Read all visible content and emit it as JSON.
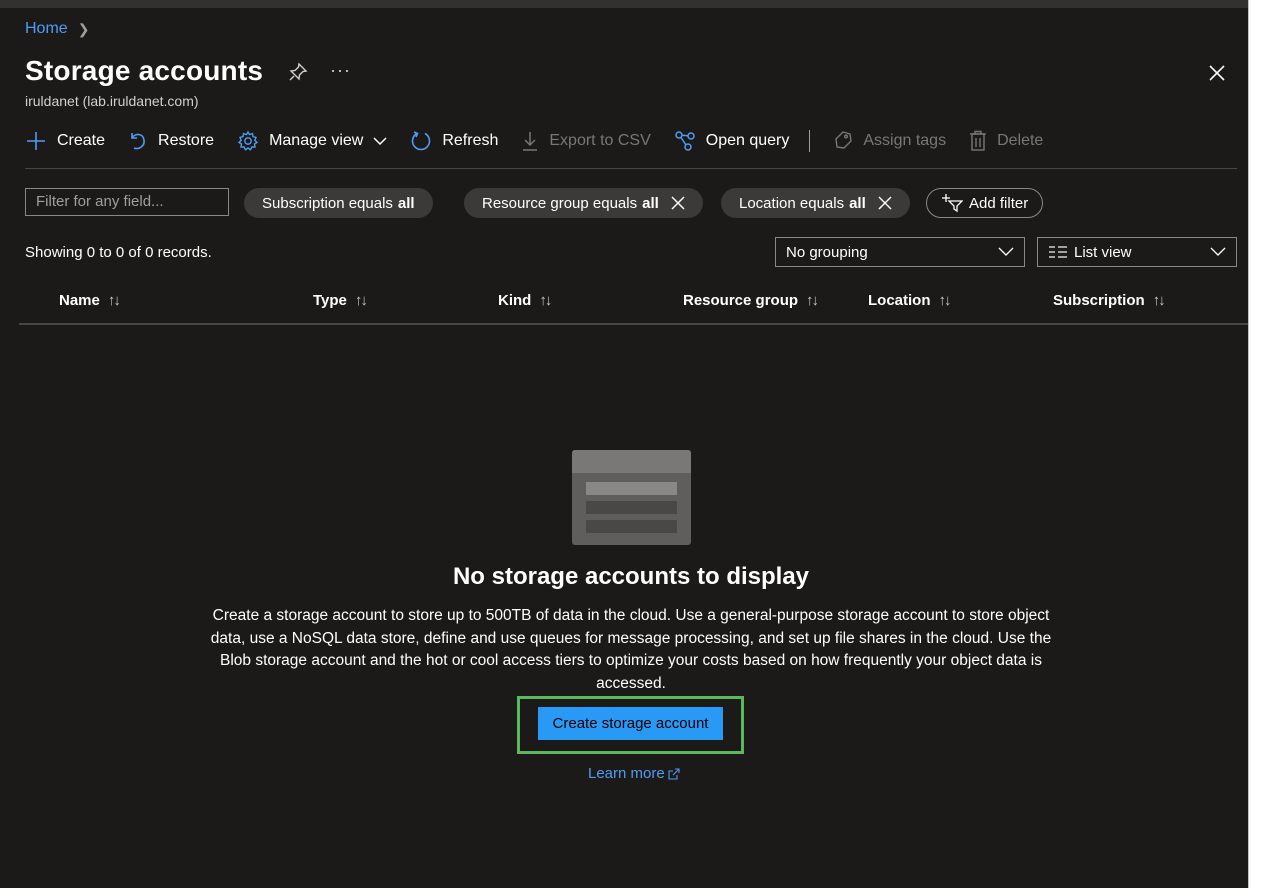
{
  "breadcrumb": {
    "home": "Home"
  },
  "header": {
    "title": "Storage accounts",
    "subtitle": "iruldanet (lab.iruldanet.com)",
    "more": "···"
  },
  "toolbar": {
    "create": "Create",
    "restore": "Restore",
    "manage_view": "Manage view",
    "refresh": "Refresh",
    "export_csv": "Export to CSV",
    "open_query": "Open query",
    "assign_tags": "Assign tags",
    "delete": "Delete"
  },
  "filters": {
    "placeholder": "Filter for any field...",
    "subscription": {
      "label": "Subscription equals",
      "value": "all"
    },
    "resource_group": {
      "label": "Resource group equals",
      "value": "all"
    },
    "location": {
      "label": "Location equals",
      "value": "all"
    },
    "add_filter": "Add filter"
  },
  "records": "Showing 0 to 0 of 0 records.",
  "grouping": "No grouping",
  "view": "List view",
  "columns": [
    "Name",
    "Type",
    "Kind",
    "Resource group",
    "Location",
    "Subscription"
  ],
  "sort_glyph": "↑↓",
  "empty": {
    "title": "No storage accounts to display",
    "description": "Create a storage account to store up to 500TB of data in the cloud. Use a general-purpose storage account to store object data, use a NoSQL data store, define and use queues for message processing, and set up file shares in the cloud. Use the Blob storage account and the hot or cool access tiers to optimize your costs based on how frequently your object data is accessed.",
    "button": "Create storage account",
    "learn_more": "Learn more"
  },
  "colors": {
    "background": "#1b1a19",
    "link": "#4f9cf5",
    "primary_button": "#2899f5",
    "highlight": "#5cb85c"
  }
}
